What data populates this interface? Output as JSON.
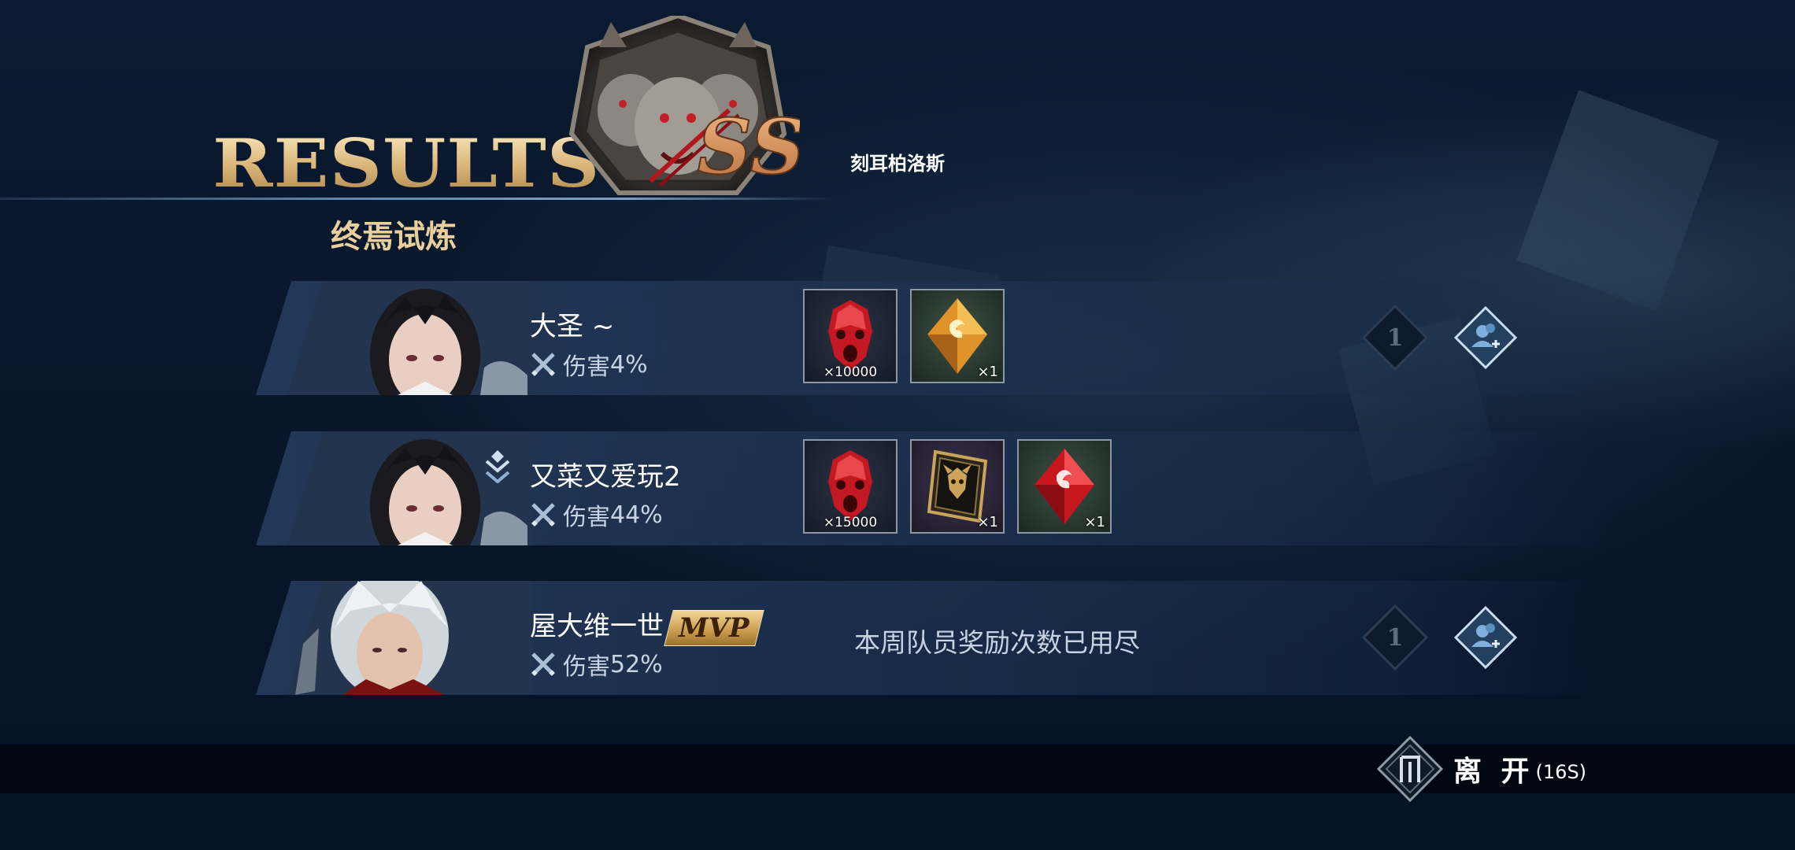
{
  "header": {
    "title": "RESULTS",
    "subtitle": "终焉试炼",
    "boss_name": "刻耳柏洛斯",
    "rank": "SS"
  },
  "rows": [
    {
      "name": "大圣 ~",
      "damage_label": "伤害",
      "damage": "4%",
      "mvp": false,
      "items": [
        {
          "icon": "red-mask-icon",
          "count": "×10000"
        },
        {
          "icon": "orange-crystal-icon",
          "count": "×1"
        }
      ],
      "like_count": "1"
    },
    {
      "name": "又菜又爱玩2",
      "damage_label": "伤害",
      "damage": "44%",
      "mvp": false,
      "items": [
        {
          "icon": "red-mask-icon",
          "count": "×15000"
        },
        {
          "icon": "demon-card-icon",
          "count": "×1"
        },
        {
          "icon": "red-crystal-icon",
          "count": "×1"
        }
      ]
    },
    {
      "name": "屋大维一世",
      "mvp_label": "MVP",
      "damage_label": "伤害",
      "damage": "52%",
      "mvp": true,
      "notice": "本周队员奖励次数已用尽",
      "like_count": "1"
    }
  ],
  "footer": {
    "exit_label": "离 开",
    "timer": "(16S)"
  },
  "colors": {
    "accent_gold": "#e6cc97",
    "background": "#07152a",
    "row": "#283e60"
  }
}
